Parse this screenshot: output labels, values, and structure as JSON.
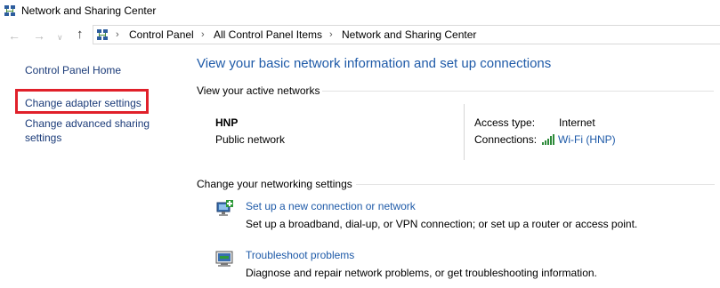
{
  "window": {
    "title": "Network and Sharing Center"
  },
  "address_bar": {
    "breadcrumbs": [
      "Control Panel",
      "All Control Panel Items",
      "Network and Sharing Center"
    ]
  },
  "left_pane": {
    "home": "Control Panel Home",
    "change_adapter": "Change adapter settings",
    "change_sharing_line1": "Change advanced sharing",
    "change_sharing_line2": "settings"
  },
  "main": {
    "title": "View your basic network information and set up connections",
    "active_networks_heading": "View your active networks",
    "network": {
      "name": "HNP",
      "type": "Public network",
      "access_type_label": "Access type:",
      "access_type_value": "Internet",
      "connections_label": "Connections:",
      "connections_value": "Wi-Fi (HNP)"
    },
    "change_settings_heading": "Change your networking settings",
    "tasks": [
      {
        "link": "Set up a new connection or network",
        "desc": "Set up a broadband, dial-up, or VPN connection; or set up a router or access point.",
        "icon": "new-connection-icon"
      },
      {
        "link": "Troubleshoot problems",
        "desc": "Diagnose and repair network problems, or get troubleshooting information.",
        "icon": "troubleshoot-icon"
      }
    ]
  },
  "colors": {
    "link": "#1e5aa8",
    "highlight_box": "#e0202a"
  }
}
